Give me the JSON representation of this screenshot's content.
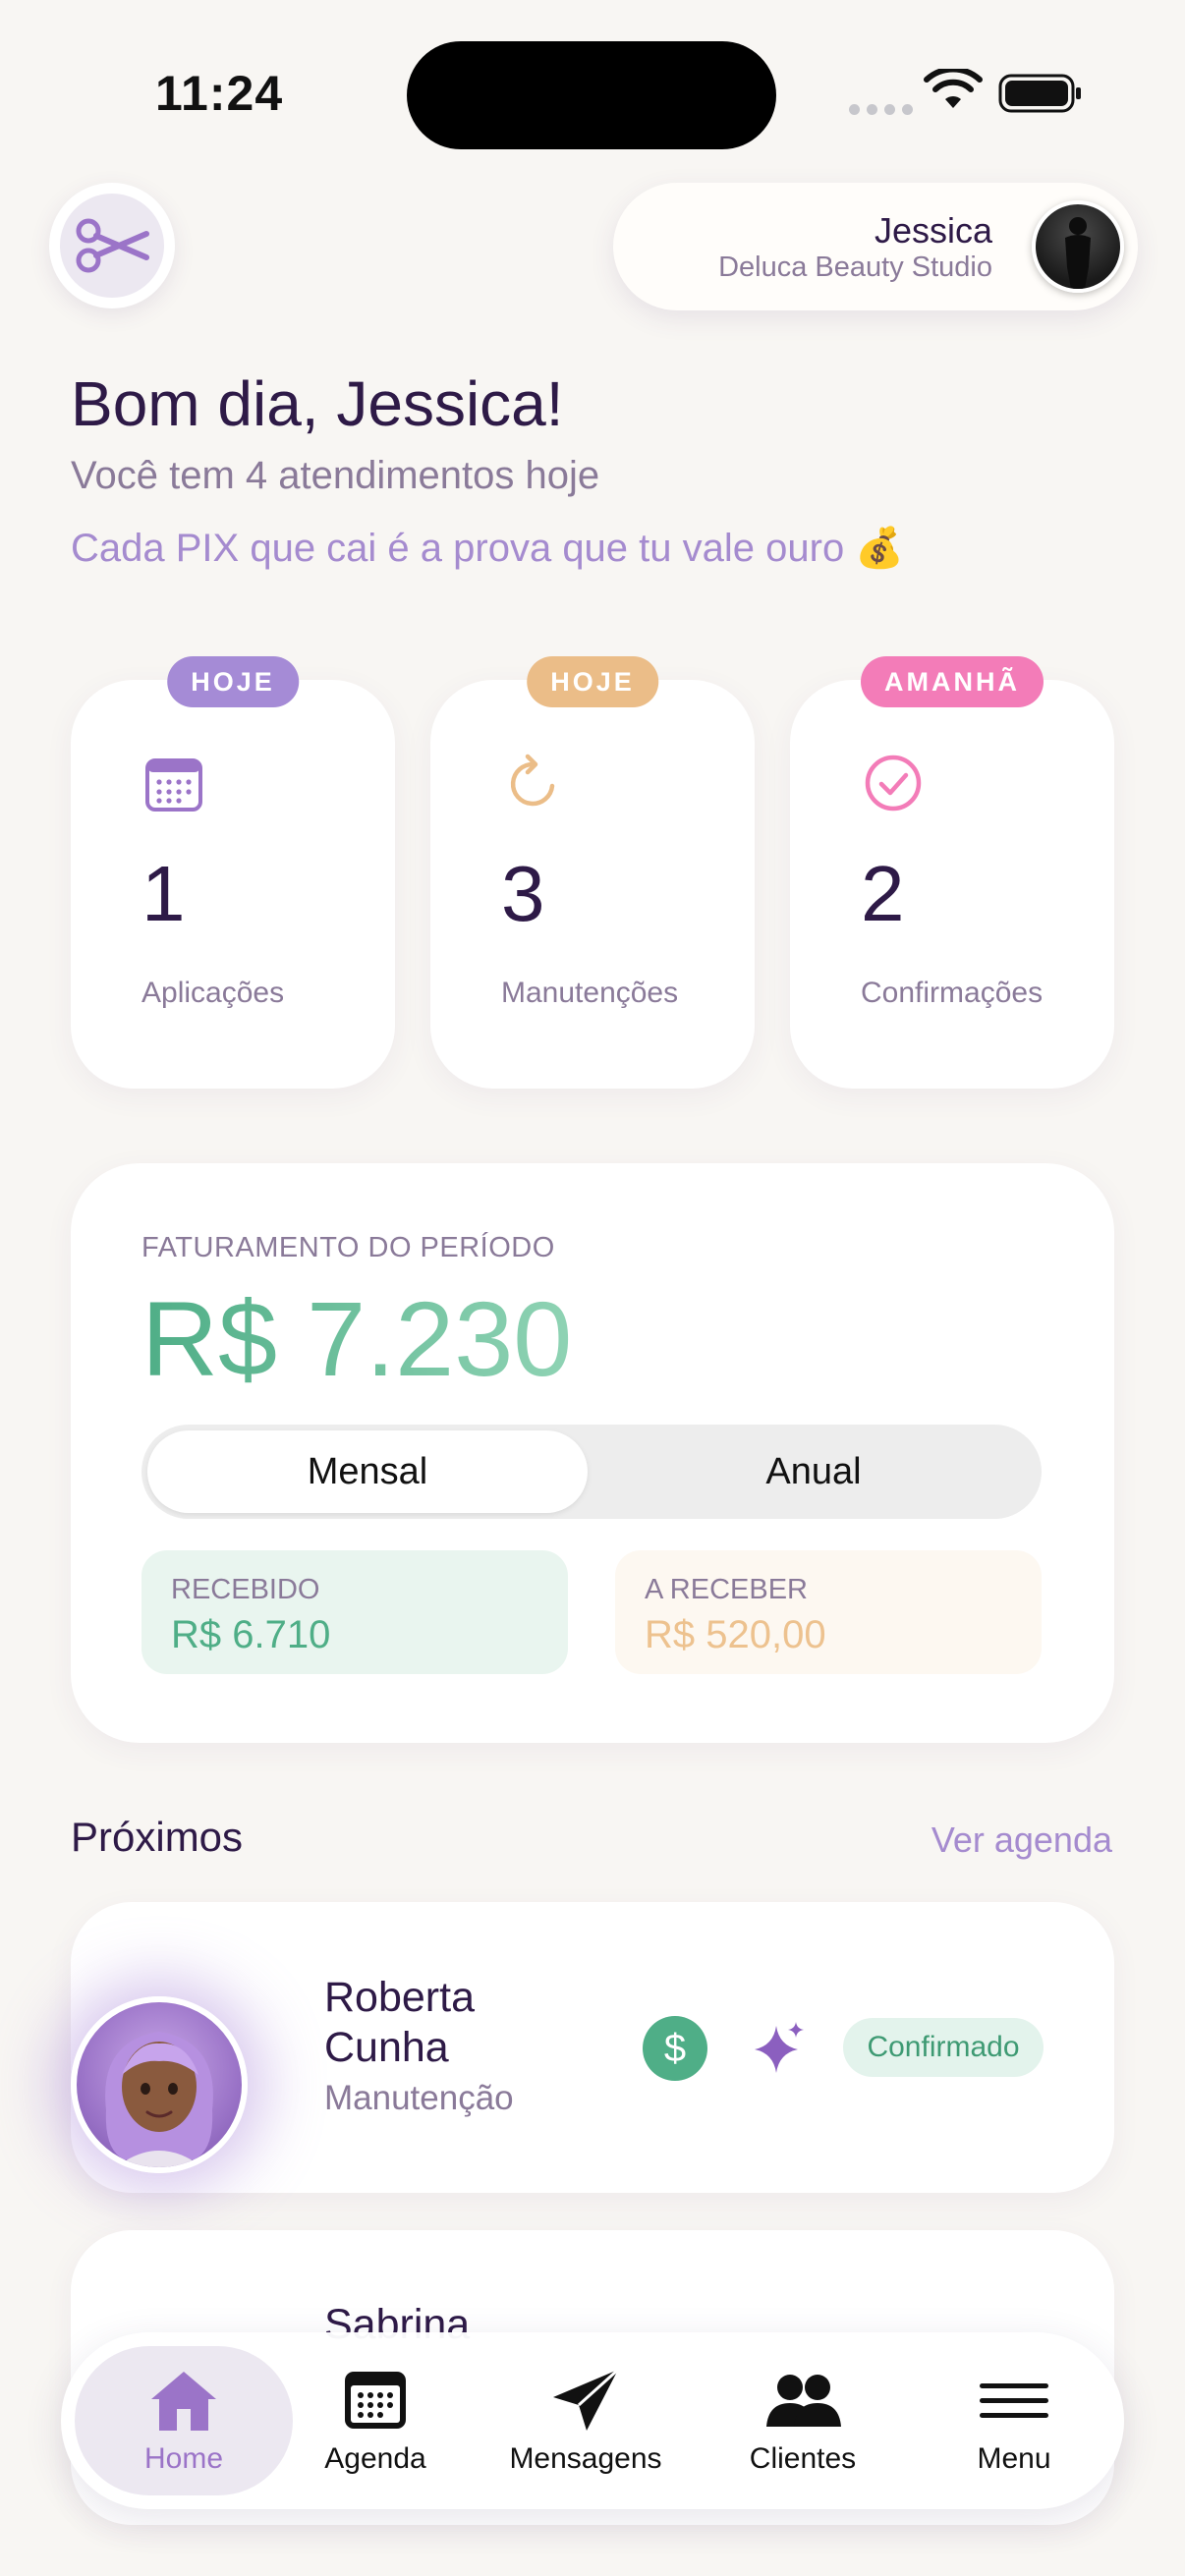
{
  "status_bar": {
    "time": "11:24"
  },
  "header": {
    "user_name": "Jessica",
    "studio": "Deluca Beauty Studio",
    "logo_icon": "scissors-icon"
  },
  "greeting": {
    "title": "Bom dia, Jessica!",
    "subtitle": "Você tem 4 atendimentos hoje",
    "motto": "Cada PIX que cai é a prova que tu vale ouro 💰"
  },
  "stats": [
    {
      "badge": "HOJE",
      "badge_color": "#a58bd6",
      "icon": "calendar-icon",
      "value": "1",
      "label": "Aplicações"
    },
    {
      "badge": "HOJE",
      "badge_color": "#ebbd88",
      "icon": "refresh-icon",
      "value": "3",
      "label": "Manutenções"
    },
    {
      "badge": "AMANHÃ",
      "badge_color": "#f37cb8",
      "icon": "check-circle-icon",
      "value": "2",
      "label": "Confirmações"
    }
  ],
  "revenue": {
    "title": "FATURAMENTO DO PERÍODO",
    "value": "R$ 7.230",
    "tabs": {
      "active": "Mensal",
      "inactive": "Anual"
    },
    "received": {
      "label": "RECEBIDO",
      "value": "R$ 6.710",
      "color": "#4fae87"
    },
    "receivable": {
      "label": "A RECEBER",
      "value": "R$ 520,00",
      "color": "#edc28f"
    }
  },
  "upcoming": {
    "title": "Próximos",
    "link": "Ver agenda",
    "items": [
      {
        "name_line1": "Roberta",
        "name_line2": "Cunha",
        "service": "Manutenção",
        "status": "Confirmado"
      },
      {
        "name_line1": "Sabrina"
      }
    ]
  },
  "nav": {
    "items": [
      {
        "label": "Home",
        "icon": "home-icon",
        "active": true
      },
      {
        "label": "Agenda",
        "icon": "calendar-icon"
      },
      {
        "label": "Mensagens",
        "icon": "send-icon"
      },
      {
        "label": "Clientes",
        "icon": "users-icon"
      },
      {
        "label": "Menu",
        "icon": "menu-icon"
      }
    ]
  },
  "colors": {
    "primary_text": "#2e1a47",
    "muted_text": "#8a7a99",
    "accent_purple": "#a58bcf",
    "success_green": "#4fae87"
  }
}
